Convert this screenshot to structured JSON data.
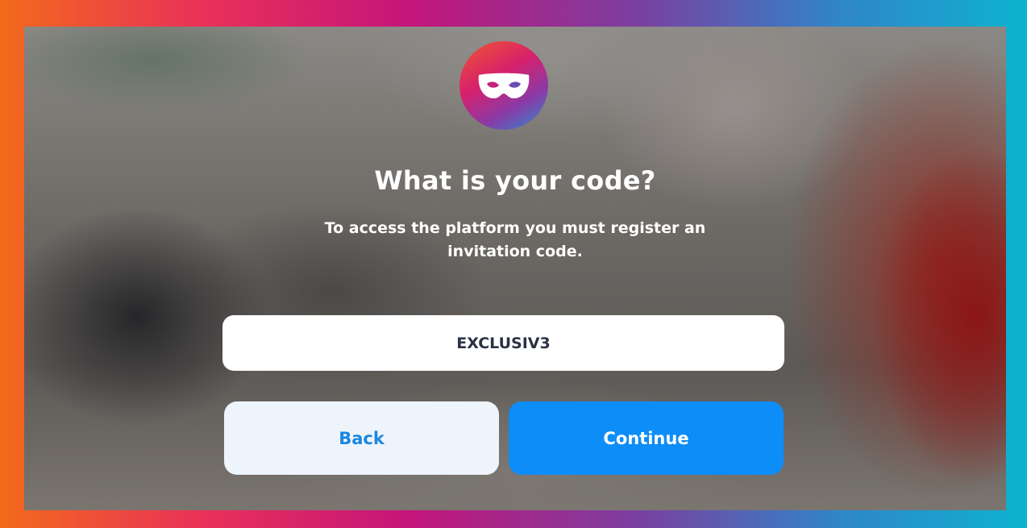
{
  "logo": {
    "icon": "mask-icon",
    "colors": [
      "#f0582d",
      "#d7206b",
      "#8a3aa6",
      "#2b8fd0"
    ]
  },
  "heading": {
    "title": "What is your code?"
  },
  "description": {
    "line1": "To access the platform you must register an",
    "line2": "invitation code."
  },
  "code_field": {
    "value": "EXCLUSIV3"
  },
  "actions": {
    "back_label": "Back",
    "continue_label": "Continue"
  },
  "colors": {
    "primary_button": "#0d8df8",
    "secondary_button": "#eef4fb",
    "secondary_text": "#1c87e0"
  }
}
